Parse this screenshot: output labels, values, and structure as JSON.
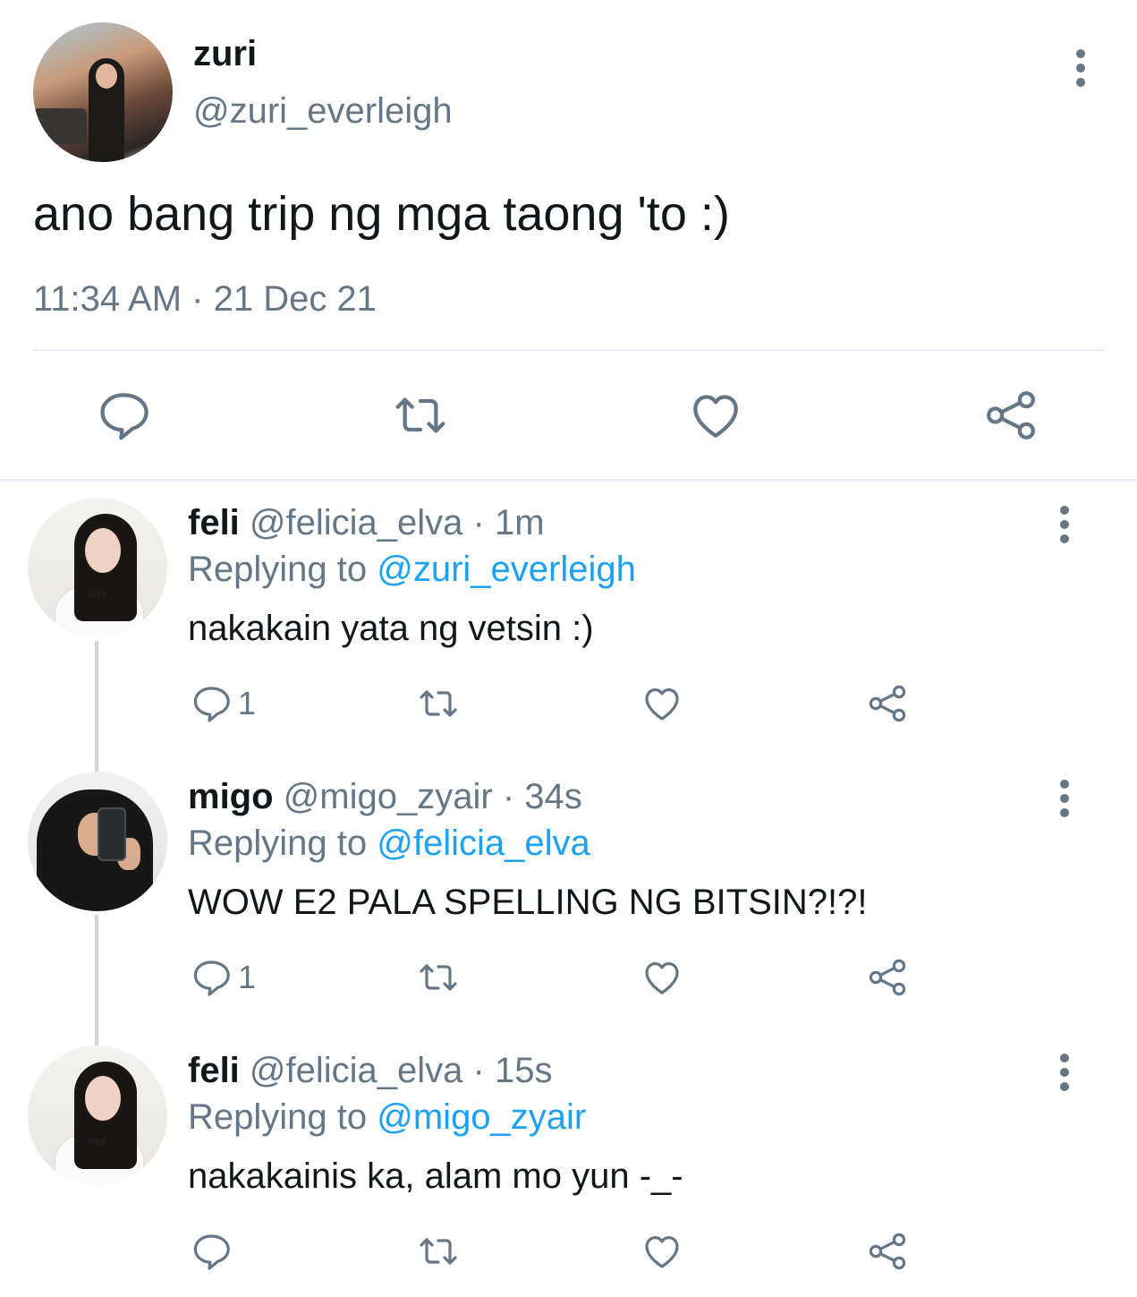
{
  "tweet": {
    "name": "zuri",
    "handle": "@zuri_everleigh",
    "text": "ano bang trip ng mga taong 'to :)",
    "timestamp": "11:34 AM · 21 Dec 21",
    "icons": [
      "reply-icon",
      "retweet-icon",
      "like-icon",
      "share-icon",
      "more-icon"
    ]
  },
  "replies": [
    {
      "name": "feli",
      "handle": "@felicia_elva",
      "time": "· 1m",
      "replying_label": "Replying to",
      "replying_to": "@zuri_everleigh",
      "text": "nakakain yata ng vetsin :)",
      "reply_count": "1"
    },
    {
      "name": "migo",
      "handle": "@migo_zyair",
      "time": "· 34s",
      "replying_label": "Replying to",
      "replying_to": "@felicia_elva",
      "text": "WOW E2 PALA SPELLING NG BITSIN?!?!",
      "reply_count": "1"
    },
    {
      "name": "feli",
      "handle": "@felicia_elva",
      "time": "· 15s",
      "replying_label": "Replying to",
      "replying_to": "@migo_zyair",
      "text": "nakakainis ka, alam mo yun -_-",
      "reply_count": ""
    }
  ],
  "colors": {
    "text": "#14171a",
    "secondary": "#657786",
    "accent": "#1da1f2",
    "divider": "#e6ecf0",
    "thread_line": "#ccd6dd"
  }
}
